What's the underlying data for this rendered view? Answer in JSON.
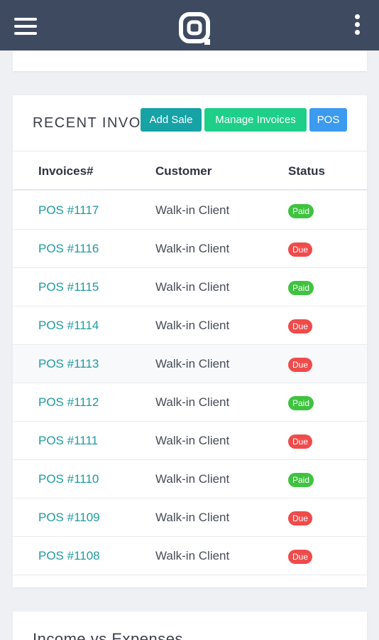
{
  "header": {
    "menu_icon": "hamburger-icon",
    "logo_icon": "app-logo",
    "more_icon": "kebab-icon",
    "bar_color": "#3e4a60"
  },
  "recent_invoices": {
    "title": "RECENT INVO",
    "buttons": {
      "add_sale": "Add Sale",
      "manage_invoices": "Manage Invoices",
      "pos": "POS"
    },
    "columns": [
      "Invoices#",
      "Customer",
      "Status"
    ],
    "rows": [
      {
        "invoice": "POS #1117",
        "customer": "Walk-in Client",
        "status": "Paid"
      },
      {
        "invoice": "POS #1116",
        "customer": "Walk-in Client",
        "status": "Due"
      },
      {
        "invoice": "POS #1115",
        "customer": "Walk-in Client",
        "status": "Paid"
      },
      {
        "invoice": "POS #1114",
        "customer": "Walk-in Client",
        "status": "Due"
      },
      {
        "invoice": "POS #1113",
        "customer": "Walk-in Client",
        "status": "Due"
      },
      {
        "invoice": "POS #1112",
        "customer": "Walk-in Client",
        "status": "Paid"
      },
      {
        "invoice": "POS #1111",
        "customer": "Walk-in Client",
        "status": "Due"
      },
      {
        "invoice": "POS #1110",
        "customer": "Walk-in Client",
        "status": "Paid"
      },
      {
        "invoice": "POS #1109",
        "customer": "Walk-in Client",
        "status": "Due"
      },
      {
        "invoice": "POS #1108",
        "customer": "Walk-in Client",
        "status": "Due"
      }
    ],
    "colors": {
      "link": "#1f9aa0",
      "paid": "#3ec33e",
      "due": "#ef4b4b"
    }
  },
  "next_card": {
    "title": "Income vs Expenses"
  }
}
